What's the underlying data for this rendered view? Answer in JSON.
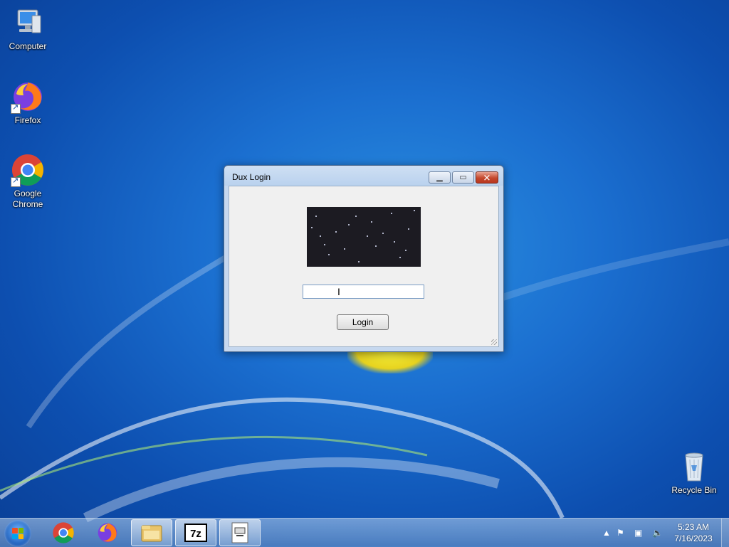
{
  "desktop": {
    "icons": [
      {
        "label": "Computer"
      },
      {
        "label": "Firefox"
      },
      {
        "label": "Google Chrome"
      },
      {
        "label": "Recycle Bin"
      }
    ]
  },
  "window": {
    "title": "Dux Login",
    "password_value": "",
    "login_label": "Login"
  },
  "taskbar": {
    "pinned": [
      "chrome-icon",
      "firefox-icon",
      "file-explorer-icon",
      "7zip-icon",
      "app-window-icon"
    ],
    "clock_time": "5:23 AM",
    "clock_date": "7/16/2023"
  },
  "colors": {
    "wallpaper": "#1b6fd0",
    "close_button": "#c5482d"
  }
}
